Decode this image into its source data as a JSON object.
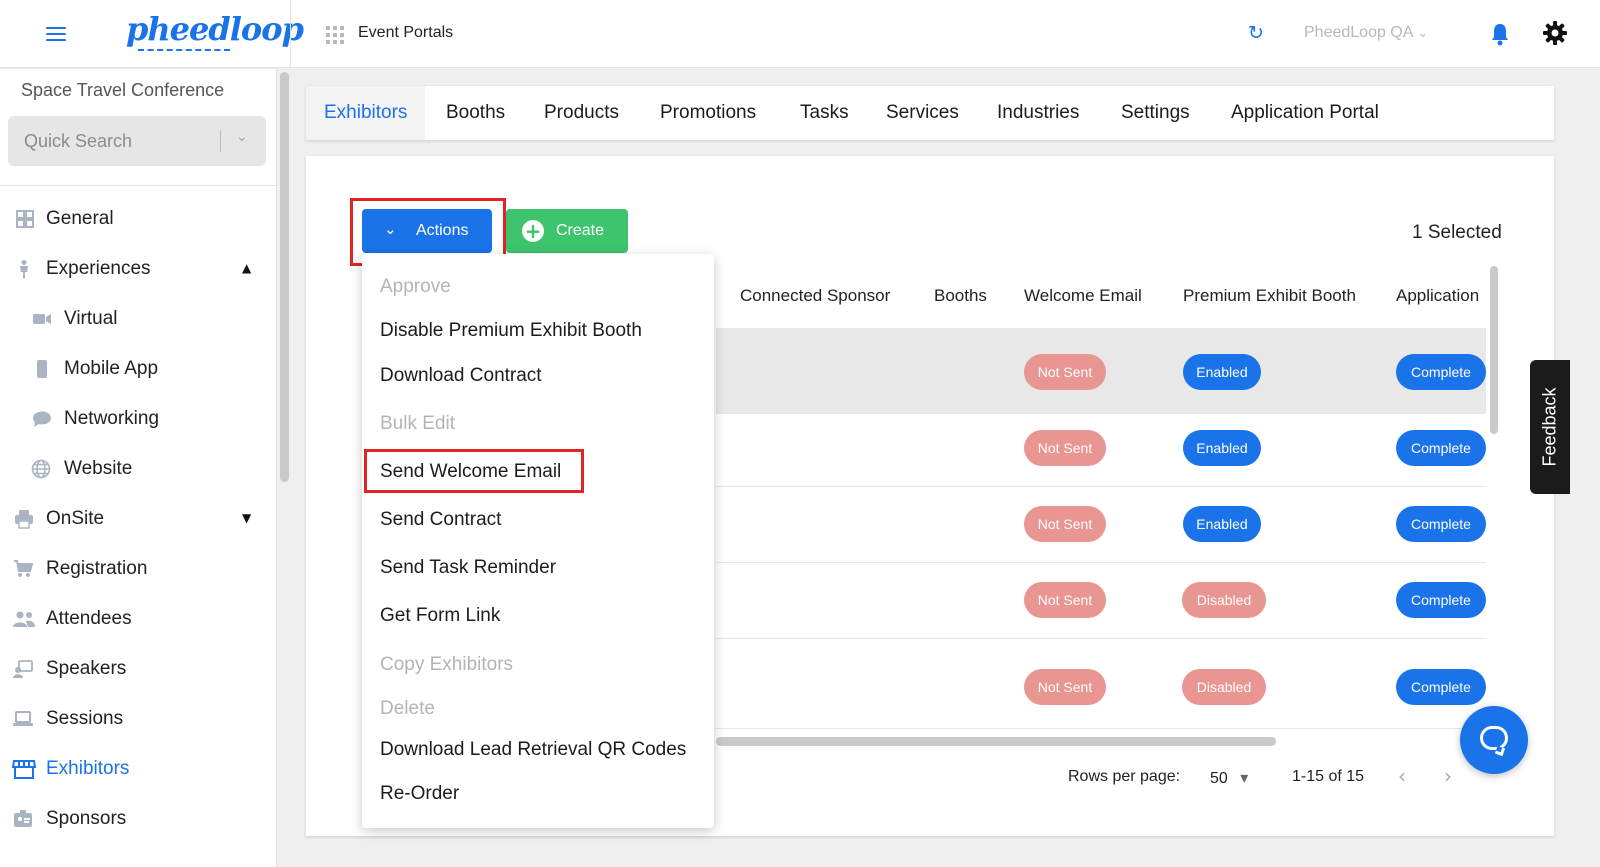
{
  "header": {
    "logo_text": "pheedloop",
    "portal_title": "Event Portals",
    "account_name": "PheedLoop QA",
    "account_chevron": "⌄",
    "refresh_glyph": "↻"
  },
  "sidebar": {
    "event_name": "Space Travel Conference",
    "search_placeholder": "Quick Search",
    "search_chevron": "⌄",
    "items": [
      {
        "label": "General",
        "icon": "grid-icon"
      },
      {
        "label": "Experiences",
        "icon": "person-icon",
        "caret": "▲"
      },
      {
        "label": "Virtual",
        "icon": "video-icon"
      },
      {
        "label": "Mobile App",
        "icon": "phone-icon"
      },
      {
        "label": "Networking",
        "icon": "chat-icon"
      },
      {
        "label": "Website",
        "icon": "globe-icon"
      },
      {
        "label": "OnSite",
        "icon": "printer-icon",
        "caret": "▼"
      },
      {
        "label": "Registration",
        "icon": "cart-icon"
      },
      {
        "label": "Attendees",
        "icon": "people-icon"
      },
      {
        "label": "Speakers",
        "icon": "presenter-icon"
      },
      {
        "label": "Sessions",
        "icon": "laptop-icon"
      },
      {
        "label": "Exhibitors",
        "icon": "store-icon"
      },
      {
        "label": "Sponsors",
        "icon": "badge-icon"
      }
    ]
  },
  "tabs": [
    "Exhibitors",
    "Booths",
    "Products",
    "Promotions",
    "Tasks",
    "Services",
    "Industries",
    "Settings",
    "Application Portal"
  ],
  "toolbar": {
    "actions_label": "Actions",
    "actions_chevron": "⌄",
    "create_label": "Create",
    "create_plus": "+",
    "selected_count": "1 Selected"
  },
  "actions_menu": [
    {
      "label": "Approve",
      "disabled": true
    },
    {
      "label": "Disable Premium Exhibit Booth",
      "disabled": false
    },
    {
      "label": "Download Contract",
      "disabled": false
    },
    {
      "label": "Bulk Edit",
      "disabled": true
    },
    {
      "label": "Send Welcome Email",
      "disabled": false,
      "highlighted": true
    },
    {
      "label": "Send Contract",
      "disabled": false
    },
    {
      "label": "Send Task Reminder",
      "disabled": false
    },
    {
      "label": "Get Form Link",
      "disabled": false
    },
    {
      "label": "Copy Exhibitors",
      "disabled": true
    },
    {
      "label": "Delete",
      "disabled": true
    },
    {
      "label": "Download Lead Retrieval QR Codes",
      "disabled": false
    },
    {
      "label": "Re-Order",
      "disabled": false
    }
  ],
  "table": {
    "columns": [
      "Connected Sponsor",
      "Booths",
      "Welcome Email",
      "Premium Exhibit Booth",
      "Application"
    ],
    "rows": [
      {
        "welcome_email": "Not Sent",
        "premium_booth": "Enabled",
        "application": "Complete",
        "selected": true
      },
      {
        "welcome_email": "Not Sent",
        "premium_booth": "Enabled",
        "application": "Complete",
        "selected": false
      },
      {
        "welcome_email": "Not Sent",
        "premium_booth": "Enabled",
        "application": "Complete",
        "selected": false
      },
      {
        "welcome_email": "Not Sent",
        "premium_booth": "Disabled",
        "application": "Complete",
        "selected": false
      },
      {
        "welcome_email": "Not Sent",
        "premium_booth": "Disabled",
        "application": "Complete",
        "selected": false
      }
    ]
  },
  "pagination": {
    "rows_per_page_label": "Rows per page:",
    "rows_per_page_value": "50",
    "rows_per_page_caret": "▾",
    "range": "1-15 of 15",
    "prev_glyph": "‹",
    "next_glyph": "›"
  },
  "feedback_label": "Feedback",
  "colors": {
    "primary": "#1a73e8",
    "create": "#3ec46d",
    "not_sent": "#e99591",
    "highlight_box": "#e02424"
  }
}
